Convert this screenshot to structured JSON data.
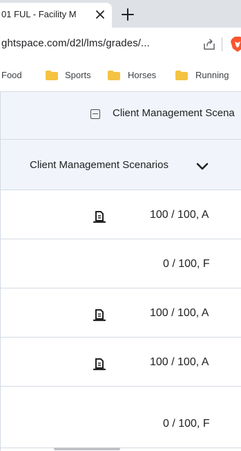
{
  "browser": {
    "tab_title": "01 FUL - Facility M",
    "url": "ghtspace.com/d2l/lms/grades/...",
    "bookmarks": [
      "Food",
      "Sports",
      "Horses",
      "Running"
    ]
  },
  "grades": {
    "group_title": "Client Management Scena",
    "column_title": "Client Management Scenarios",
    "rows": [
      {
        "score": "100 / 100, A",
        "has_feedback_icon": true
      },
      {
        "score": "0 / 100, F",
        "has_feedback_icon": false
      },
      {
        "score": "100 / 100, A",
        "has_feedback_icon": true
      },
      {
        "score": "100 / 100, A",
        "has_feedback_icon": true
      },
      {
        "score": "0 / 100, F",
        "has_feedback_icon": false
      }
    ]
  },
  "icons": {
    "tab_close": "close-icon",
    "new_tab": "plus-icon",
    "share": "share-icon",
    "brave": "brave-lion-icon",
    "folder": "folder-icon",
    "group_toggle": "collapse-icon",
    "column_menu": "chevron-down-icon",
    "feedback": "document-feedback-icon"
  },
  "colors": {
    "folder": "#f5c342",
    "header_bg": "#f1f5fb",
    "brave": "#fb542b"
  }
}
